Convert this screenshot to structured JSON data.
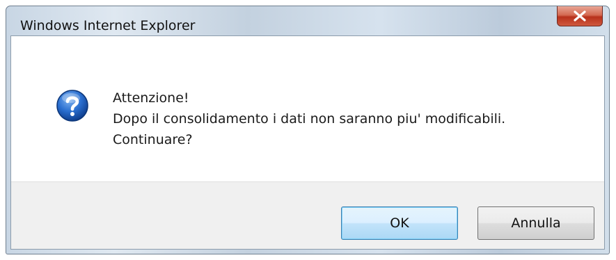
{
  "window": {
    "title": "Windows Internet Explorer"
  },
  "dialog": {
    "icon": "question-icon",
    "message_lines": [
      "Attenzione!",
      "Dopo il consolidamento i dati non saranno piu' modificabili.",
      "Continuare?"
    ],
    "buttons": {
      "ok_label": "OK",
      "cancel_label": "Annulla"
    }
  },
  "colors": {
    "close_button": "#c8432a",
    "default_button_border": "#3c7fb1",
    "icon_blue": "#1f63c4"
  }
}
